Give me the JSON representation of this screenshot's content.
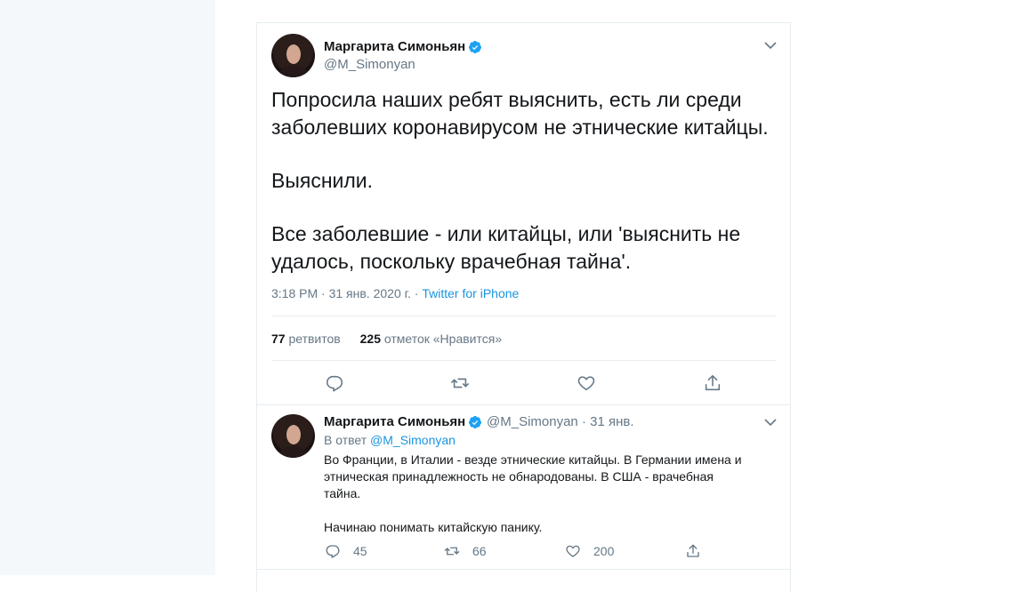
{
  "main_tweet": {
    "author_name": "Маргарита Симоньян",
    "author_handle": "@M_Simonyan",
    "text_p1": "Попросила наших ребят выяснить, есть ли среди\nзаболевших коронавирусом не этнические китайцы.",
    "text_p2": "Выяснили.",
    "text_p3": "Все заболевшие - или китайцы, или 'выяснить не\nудалось, поскольку врачебная тайна'.",
    "time": "3:18 PM",
    "date": "31 янв. 2020 г.",
    "source": "Twitter for iPhone",
    "retweets_count": "77",
    "retweets_label": "ретвитов",
    "likes_count": "225",
    "likes_label": "отметок «Нравится»"
  },
  "reply_tweet": {
    "author_name": "Маргарита Симоньян",
    "author_handle": "@M_Simonyan",
    "date": "31 янв.",
    "in_reply_label": "В ответ",
    "in_reply_handle": "@M_Simonyan",
    "text_p1": "Во Франции, в Италии - везде этнические китайцы. В Германии имена и\nэтническая принадлежность не обнародованы. В США - врачебная\nтайна.",
    "text_p2": "Начинаю понимать китайскую панику.",
    "reply_count": "45",
    "retweet_count": "66",
    "like_count": "200"
  },
  "colors": {
    "accent": "#1b95e0",
    "muted": "#657786",
    "text": "#14171a",
    "border": "#e6ecf0"
  },
  "icons": [
    "verified-icon",
    "chevron-down-icon",
    "reply-icon",
    "retweet-icon",
    "like-icon",
    "share-icon"
  ]
}
